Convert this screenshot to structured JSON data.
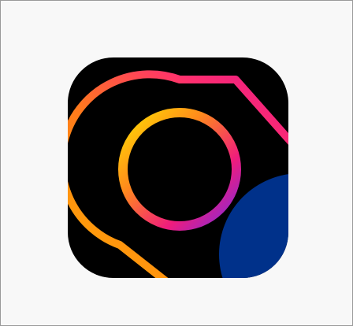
{
  "icon": {
    "name": "app-icon",
    "background_color": "#000000",
    "corner_color": "#00318a",
    "ring_gradient": [
      "#ffd400",
      "#ff8a1a",
      "#ff2d7a",
      "#e5118b",
      "#8a2bd8"
    ]
  }
}
